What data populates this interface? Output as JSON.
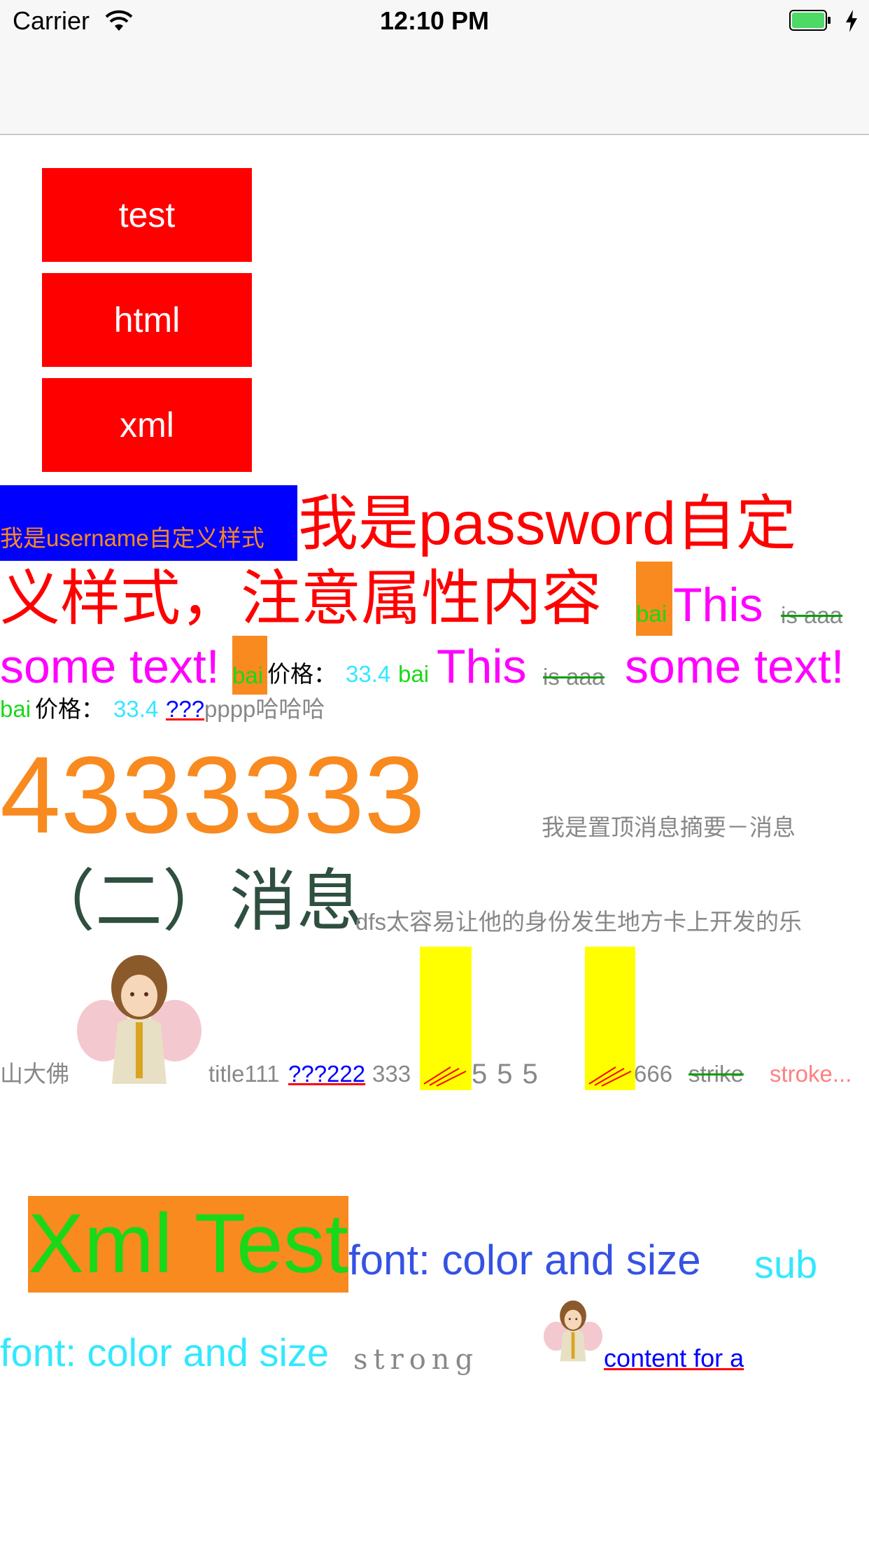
{
  "status_bar": {
    "carrier": "Carrier",
    "time": "12:10 PM"
  },
  "buttons": {
    "test": "test",
    "html": "html",
    "xml": "xml"
  },
  "line1": {
    "username": "我是username自定义样式",
    "password_a": "我是password自定",
    "password_b": "义样式，注意属性内容"
  },
  "bai": "bai",
  "this": "This",
  "is_aaa": "is aaa",
  "some_text": "some text!",
  "price_label": "价格：",
  "price_value": "33.4",
  "qqq": "???",
  "pppp": "pppp哈哈哈",
  "big_number": "4333333",
  "summary": "我是置顶消息摘要－消息",
  "section_two": "（二）消息",
  "dfs": "dfs太容易让他的身份发生地方卡上开发的乐",
  "shanda": "山大佛",
  "title111": "title111",
  "q222": "???222",
  "n333": "333",
  "n555": "555",
  "n666": "666",
  "strike": "strike",
  "stroke": "stroke...",
  "xml_test": "Xml Test",
  "font_color_size": "font: color and size",
  "sub": "sub",
  "strong": "strong",
  "content_for_a": "content for a",
  "colors": {
    "red": "#ff0000",
    "blue": "#0000ff",
    "orange": "#f88a1f",
    "magenta": "#ff00ff",
    "cyan": "#33e8ff",
    "green": "#19d819",
    "yellow": "#ffff00",
    "gray": "#888888",
    "dark_green": "#2f4f3f",
    "royal_blue": "#3552e3"
  }
}
